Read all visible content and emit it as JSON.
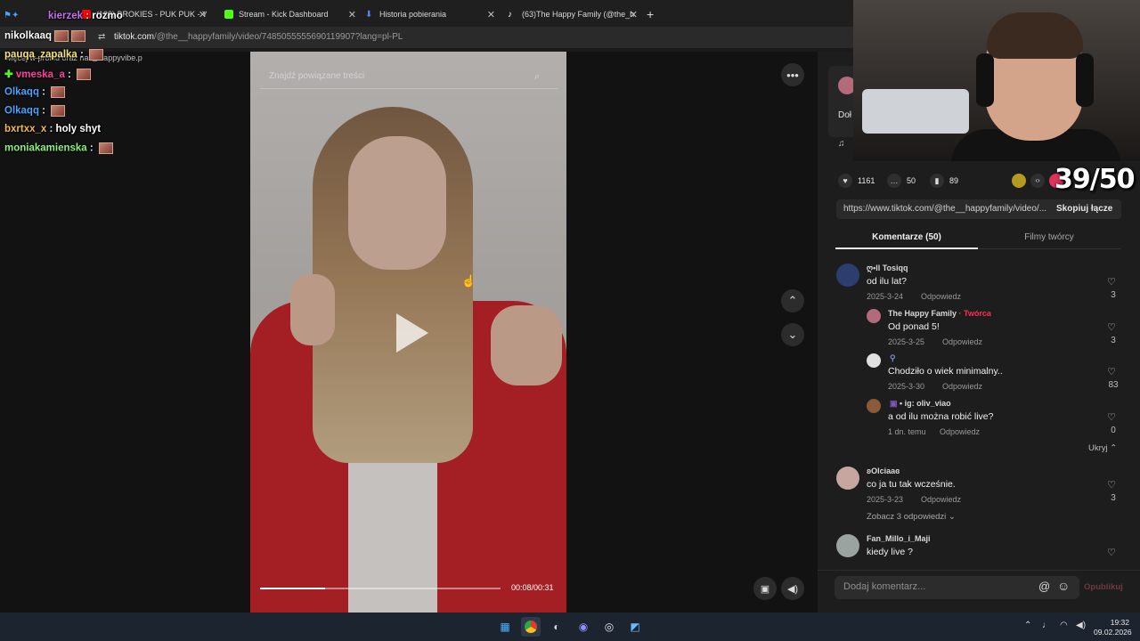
{
  "browser": {
    "tabs": [
      {
        "title": "(133) BROKIES - PUK PUK - You",
        "color": "#ff0000"
      },
      {
        "title": "Stream - Kick Dashboard",
        "color": "#53fc18"
      },
      {
        "title": "Historia pobierania",
        "color": "#4a8bf5"
      },
      {
        "title": "(63)The Happy Family (@the_h",
        "color": "#ffffff"
      }
    ],
    "new_tab": "+",
    "url_host": "tiktok.com",
    "url_path": "/@the__happyfamily/video/7485055555690119907?lang=pl-PL"
  },
  "chat": [
    {
      "user": "kierzek",
      "message": "rozmo",
      "color": "#c76df0"
    },
    {
      "user": "nikolkaaq",
      "message": "",
      "color": "#ffffff"
    },
    {
      "user": "pauqa_zapalka",
      "message": "",
      "color": "#f5e47a"
    },
    {
      "user": "vmeska_a",
      "message": "",
      "color": "#ff3ea0"
    },
    {
      "user": "Olkaqq",
      "message": "",
      "color": "#4aa3ff"
    },
    {
      "user": "Olkaqq",
      "message": "",
      "color": "#4aa3ff"
    },
    {
      "user": "bxrtxx_x",
      "message": "holy shyt",
      "color": "#f5b84a"
    },
    {
      "user": "moniakamienska",
      "message": "",
      "color": "#8ef07a"
    }
  ],
  "chat_overlap_text": "więcej w profilu oraz na @happyvibe.p",
  "video": {
    "search_placeholder": "Znajdź powiązane treści",
    "time": "00:08/00:31",
    "progress": 0.27
  },
  "video_icons": {
    "more": "more-icon",
    "up": "chevron-up-icon",
    "down": "chevron-down-icon",
    "volume": "volume-icon"
  },
  "right": {
    "counter": "39/50",
    "creator_snippet": "Doł",
    "stats": {
      "likes": "1161",
      "comments": "50",
      "saves": "89"
    },
    "link": "https://www.tiktok.com/@the__happyfamily/video/...",
    "copy_label": "Skopiuj łącze",
    "tab_comments": "Komentarze (50)",
    "tab_creator": "Filmy twórcy",
    "comments": [
      {
        "user": "ღ•ll Tosiqq",
        "text": "od ilu lat?",
        "date": "2025-3-24",
        "reply": "Odpowiedz",
        "likes": "3"
      },
      {
        "user": "The Happy Family",
        "badge": "· Twórca",
        "text": "Od ponad 5!",
        "date": "2025-3-25",
        "reply": "Odpowiedz",
        "likes": "3"
      },
      {
        "user": "",
        "text": "Chodziło o wiek minimalny..",
        "date": "2025-3-30",
        "reply": "Odpowiedz",
        "likes": "83"
      },
      {
        "user": "• ig: oliv_viao",
        "text": "a od ilu można robić live?",
        "date": "1 dn. temu",
        "reply": "Odpowiedz",
        "likes": "0"
      },
      {
        "user": "ʚOlciaaɞ",
        "text": "co ja tu tak wcześnie.",
        "date": "2025-3-23",
        "reply": "Odpowiedz",
        "likes": "3"
      },
      {
        "user": "Fan_Millo_i_Maji",
        "text": "kiedy live ?",
        "date": "",
        "reply": "",
        "likes": ""
      }
    ],
    "hide_label": "Ukryj",
    "see_replies": "Zobacz 3 odpowiedzi",
    "comment_placeholder": "Dodaj komentarz...",
    "publish": "Opublikuj"
  },
  "taskbar": {
    "time": "19:32",
    "date": "09.02.2026"
  }
}
